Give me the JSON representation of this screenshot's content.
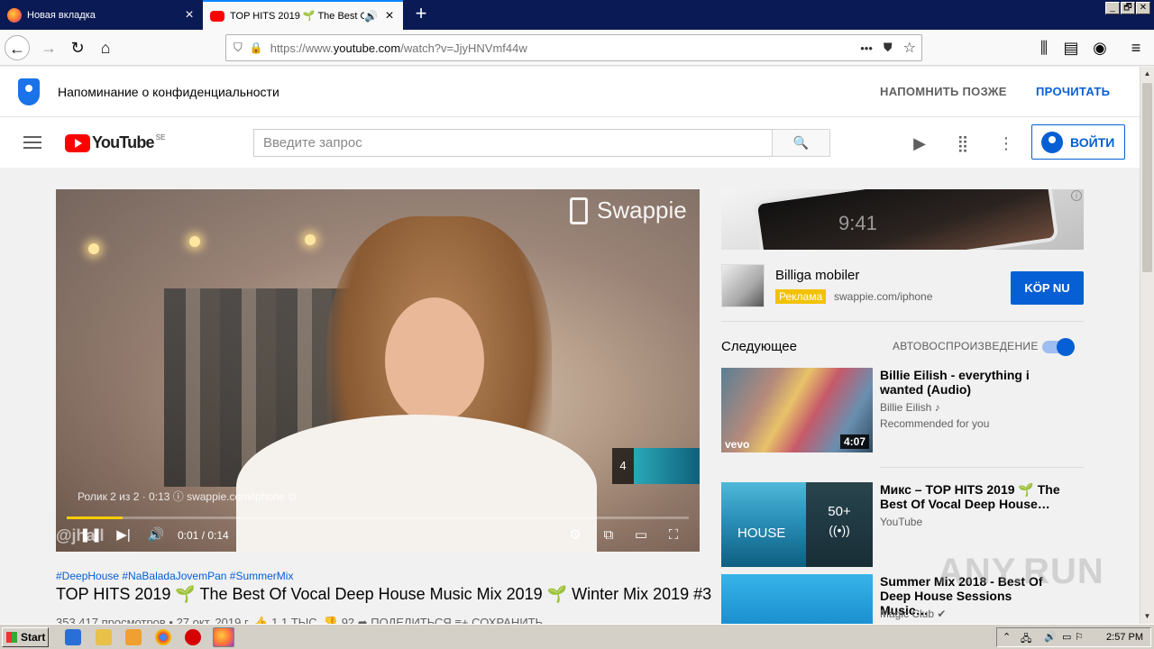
{
  "browser": {
    "tabs": [
      {
        "label": "Новая вкладка",
        "active": false
      },
      {
        "label": "TOP HITS 2019 🌱 The Best Of",
        "active": true
      }
    ],
    "new_tab_symbol": "+",
    "url_prefix": "https://www.",
    "url_host": "youtube.com",
    "url_path": "/watch?v=JjyHNVmf44w",
    "page_action_dots": "•••",
    "window_buttons": [
      "_",
      "🗗",
      "✕"
    ]
  },
  "privacy_banner": {
    "text": "Напоминание о конфиденциальности",
    "remind_later": "НАПОМНИТЬ ПОЗЖЕ",
    "read": "ПРОЧИТАТЬ"
  },
  "yt_header": {
    "logo_text": "YouTube",
    "country_code": "SE",
    "search_placeholder": "Введите запрос",
    "signin_label": "ВОЙТИ"
  },
  "player": {
    "brand_overlay": "Swappie",
    "ad_info": "Ролик 2 из 2 · 0:13 ⓘ   swappie.com/iphone ⧉",
    "next_count": "4",
    "progress_fraction": 0.09,
    "time": "0:01 / 0:14",
    "channel_watermark": "@jhall"
  },
  "video": {
    "tags": "#DeepHouse #NaBaladaJovemPan #SummerMix",
    "title": "TOP HITS 2019 🌱 The Best Of Vocal Deep House Music Mix 2019 🌱 Winter Mix 2019 #3",
    "meta": "353 417 просмотров • 27 окт. 2019 г.     👍 1,1 ТЫС.     👎 92     ➦ ПОДЕЛИТЬСЯ     ≡+ СОХРАНИТЬ"
  },
  "ad": {
    "banner_clock": "9:41",
    "title": "Billiga mobiler",
    "badge": "Реклама",
    "url": "swappie.com/iphone",
    "cta": "KÖP NU"
  },
  "sidebar": {
    "up_next_label": "Следующее",
    "autoplay_label": "АВТОВОСПРОИЗВЕДЕНИЕ",
    "autoplay_on": true,
    "items": [
      {
        "title": "Billie Eilish - everything i wanted (Audio)",
        "channel": "Billie Eilish ♪",
        "sub": "Recommended for you",
        "duration": "4:07",
        "thumb_tag": "vevo"
      },
      {
        "title": "Микс – TOP HITS 2019 🌱 The Best Of Vocal Deep House…",
        "channel": "YouTube",
        "sub": "",
        "playlist_count": "50+",
        "thumb_tag": "HOUSE"
      },
      {
        "title": "Summer Mix 2018 - Best Of Deep House Sessions Music…",
        "channel": "Magic Club ✔",
        "sub": ""
      }
    ]
  },
  "watermark": "ANY.RUN",
  "taskbar": {
    "start_label": "Start",
    "clock": "2:57 PM"
  },
  "colors": {
    "accent_blue": "#065fd4",
    "yt_red": "#ff0000",
    "progress_yellow": "#ffcc00",
    "ad_badge": "#f2c200"
  }
}
